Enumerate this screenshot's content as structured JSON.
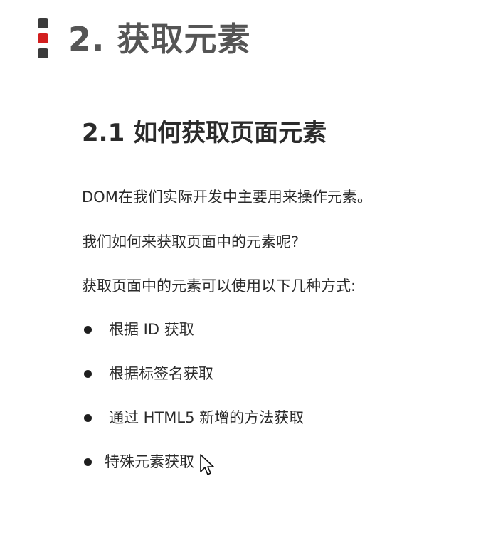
{
  "section": {
    "marker_icon": "three-block-marker",
    "marker_accent": "#d21f1f",
    "title": "2. 获取元素"
  },
  "subsection": {
    "title": "2.1 如何获取页面元素"
  },
  "paragraphs": [
    "DOM在我们实际开发中主要用来操作元素。",
    "我们如何来获取页面中的元素呢?",
    "获取页面中的元素可以使用以下几种方式:"
  ],
  "bullets": [
    "根据 ID 获取",
    "根据标签名获取",
    "通过 HTML5 新增的方法获取",
    "特殊元素获取"
  ],
  "cursor_icon": "mouse-pointer-icon"
}
